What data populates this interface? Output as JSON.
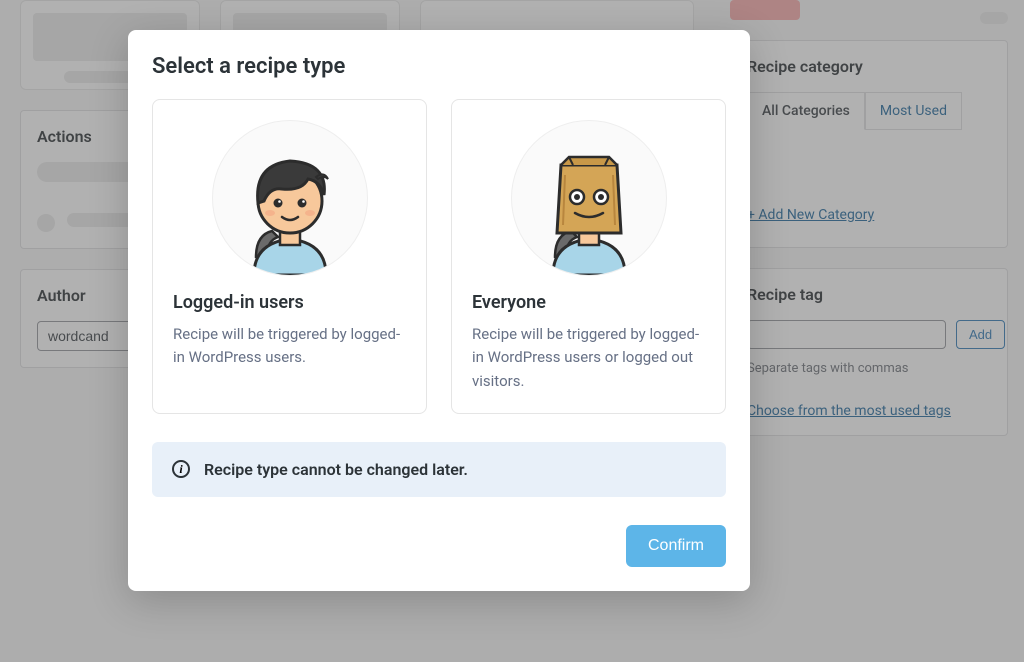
{
  "background": {
    "actions_title": "Actions",
    "author_title": "Author",
    "author_value": "wordcand",
    "category_title": "Recipe category",
    "category_tab_all": "All Categories",
    "category_tab_most": "Most Used",
    "add_category_link": "+ Add New Category",
    "tag_title": "Recipe tag",
    "add_button": "Add",
    "tag_hint": "Separate tags with commas",
    "most_used_tags_link": "Choose from the most used tags"
  },
  "modal": {
    "title": "Select a recipe type",
    "options": [
      {
        "title": "Logged-in users",
        "description": "Recipe will be triggered by logged-in WordPress users."
      },
      {
        "title": "Everyone",
        "description": "Recipe will be triggered by logged-in WordPress users or logged out visitors."
      }
    ],
    "info_text": "Recipe type cannot be changed later.",
    "confirm_label": "Confirm"
  }
}
